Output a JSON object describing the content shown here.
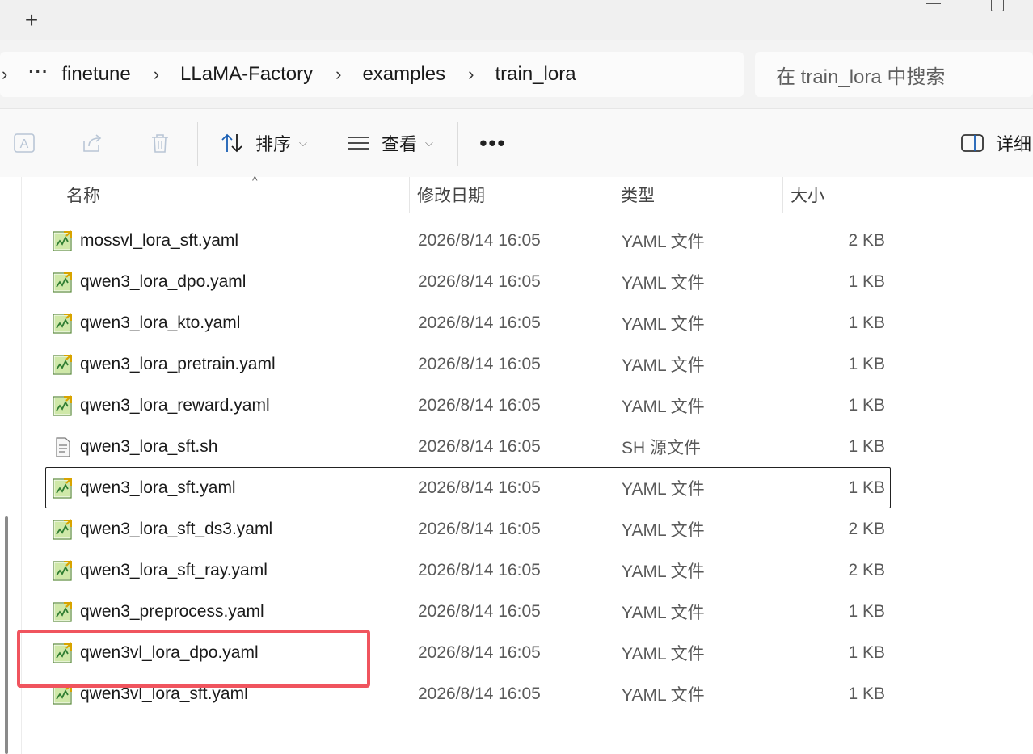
{
  "window": {
    "new_tab": "+"
  },
  "breadcrumb": {
    "more": "···",
    "items": [
      "finetune",
      "LLaMA-Factory",
      "examples",
      "train_lora"
    ]
  },
  "search": {
    "placeholder": "在 train_lora 中搜索"
  },
  "toolbar": {
    "sort_label": "排序",
    "view_label": "查看",
    "more_label": "•••",
    "details_label": "详细"
  },
  "columns": {
    "name": "名称",
    "modified": "修改日期",
    "type": "类型",
    "size": "大小"
  },
  "files": [
    {
      "name": "mossvl_lora_sft.yaml",
      "modified": "2026/8/14 16:05",
      "type": "YAML 文件",
      "size": "2 KB",
      "icon": "yaml-file-icon"
    },
    {
      "name": "qwen3_lora_dpo.yaml",
      "modified": "2026/8/14 16:05",
      "type": "YAML 文件",
      "size": "1 KB",
      "icon": "yaml-file-icon"
    },
    {
      "name": "qwen3_lora_kto.yaml",
      "modified": "2026/8/14 16:05",
      "type": "YAML 文件",
      "size": "1 KB",
      "icon": "yaml-file-icon"
    },
    {
      "name": "qwen3_lora_pretrain.yaml",
      "modified": "2026/8/14 16:05",
      "type": "YAML 文件",
      "size": "1 KB",
      "icon": "yaml-file-icon"
    },
    {
      "name": "qwen3_lora_reward.yaml",
      "modified": "2026/8/14 16:05",
      "type": "YAML 文件",
      "size": "1 KB",
      "icon": "yaml-file-icon"
    },
    {
      "name": "qwen3_lora_sft.sh",
      "modified": "2026/8/14 16:05",
      "type": "SH 源文件",
      "size": "1 KB",
      "icon": "shell-file-icon"
    },
    {
      "name": "qwen3_lora_sft.yaml",
      "modified": "2026/8/14 16:05",
      "type": "YAML 文件",
      "size": "1 KB",
      "icon": "yaml-file-icon",
      "selected": true
    },
    {
      "name": "qwen3_lora_sft_ds3.yaml",
      "modified": "2026/8/14 16:05",
      "type": "YAML 文件",
      "size": "2 KB",
      "icon": "yaml-file-icon"
    },
    {
      "name": "qwen3_lora_sft_ray.yaml",
      "modified": "2026/8/14 16:05",
      "type": "YAML 文件",
      "size": "2 KB",
      "icon": "yaml-file-icon"
    },
    {
      "name": "qwen3_preprocess.yaml",
      "modified": "2026/8/14 16:05",
      "type": "YAML 文件",
      "size": "1 KB",
      "icon": "yaml-file-icon"
    },
    {
      "name": "qwen3vl_lora_dpo.yaml",
      "modified": "2026/8/14 16:05",
      "type": "YAML 文件",
      "size": "1 KB",
      "icon": "yaml-file-icon"
    },
    {
      "name": "qwen3vl_lora_sft.yaml",
      "modified": "2026/8/14 16:05",
      "type": "YAML 文件",
      "size": "1 KB",
      "icon": "yaml-file-icon"
    }
  ],
  "colors": {
    "highlight": "#f0545e",
    "accent": "#0067c0"
  }
}
